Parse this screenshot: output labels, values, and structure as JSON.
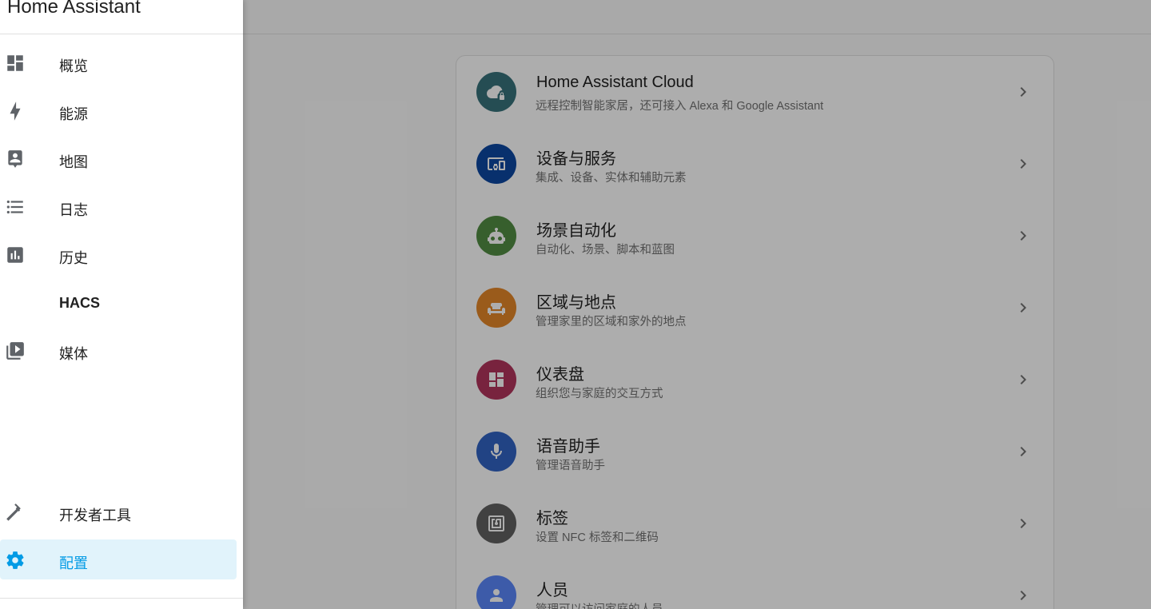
{
  "app": {
    "title": "Home Assistant"
  },
  "sidebar": {
    "items": [
      {
        "label": "概览",
        "icon": "dashboard-icon"
      },
      {
        "label": "能源",
        "icon": "lightning-bolt-icon"
      },
      {
        "label": "地图",
        "icon": "map-account-icon"
      },
      {
        "label": "日志",
        "icon": "format-list-bulleted-icon"
      },
      {
        "label": "历史",
        "icon": "chart-box-icon"
      },
      {
        "label": "HACS",
        "icon": ""
      },
      {
        "label": "媒体",
        "icon": "play-box-multiple-icon"
      }
    ],
    "bottom_items": [
      {
        "label": "开发者工具",
        "icon": "hammer-icon"
      },
      {
        "label": "配置",
        "icon": "cog-icon",
        "active": true
      }
    ]
  },
  "config": {
    "items": [
      {
        "title": "Home Assistant Cloud",
        "subtitle": "远程控制智能家居，还可接入 Alexa 和 Google Assistant",
        "icon": "cloud-lock-icon",
        "color": "#37727b"
      },
      {
        "title": "设备与服务",
        "subtitle": "集成、设备、实体和辅助元素",
        "icon": "devices-icon",
        "color": "#0d47a1"
      },
      {
        "title": "场景自动化",
        "subtitle": "自动化、场景、脚本和蓝图",
        "icon": "robot-icon",
        "color": "#518c43"
      },
      {
        "title": "区域与地点",
        "subtitle": "管理家里的区域和家外的地点",
        "icon": "sofa-icon",
        "color": "#e48629"
      },
      {
        "title": "仪表盘",
        "subtitle": "组织您与家庭的交互方式",
        "icon": "view-dashboard-icon",
        "color": "#b1345c"
      },
      {
        "title": "语音助手",
        "subtitle": "管理语音助手",
        "icon": "microphone-icon",
        "color": "#3263c3"
      },
      {
        "title": "标签",
        "subtitle": "设置 NFC 标签和二维码",
        "icon": "nfc-tag-icon",
        "color": "#616161"
      },
      {
        "title": "人员",
        "subtitle": "管理可以访问家庭的人员",
        "icon": "account-icon",
        "color": "#5a87fa"
      }
    ]
  },
  "colors": {
    "accent": "#039be5",
    "active_bg": "#e1f3fb",
    "overlay": "rgba(0,0,0,0.32)"
  }
}
